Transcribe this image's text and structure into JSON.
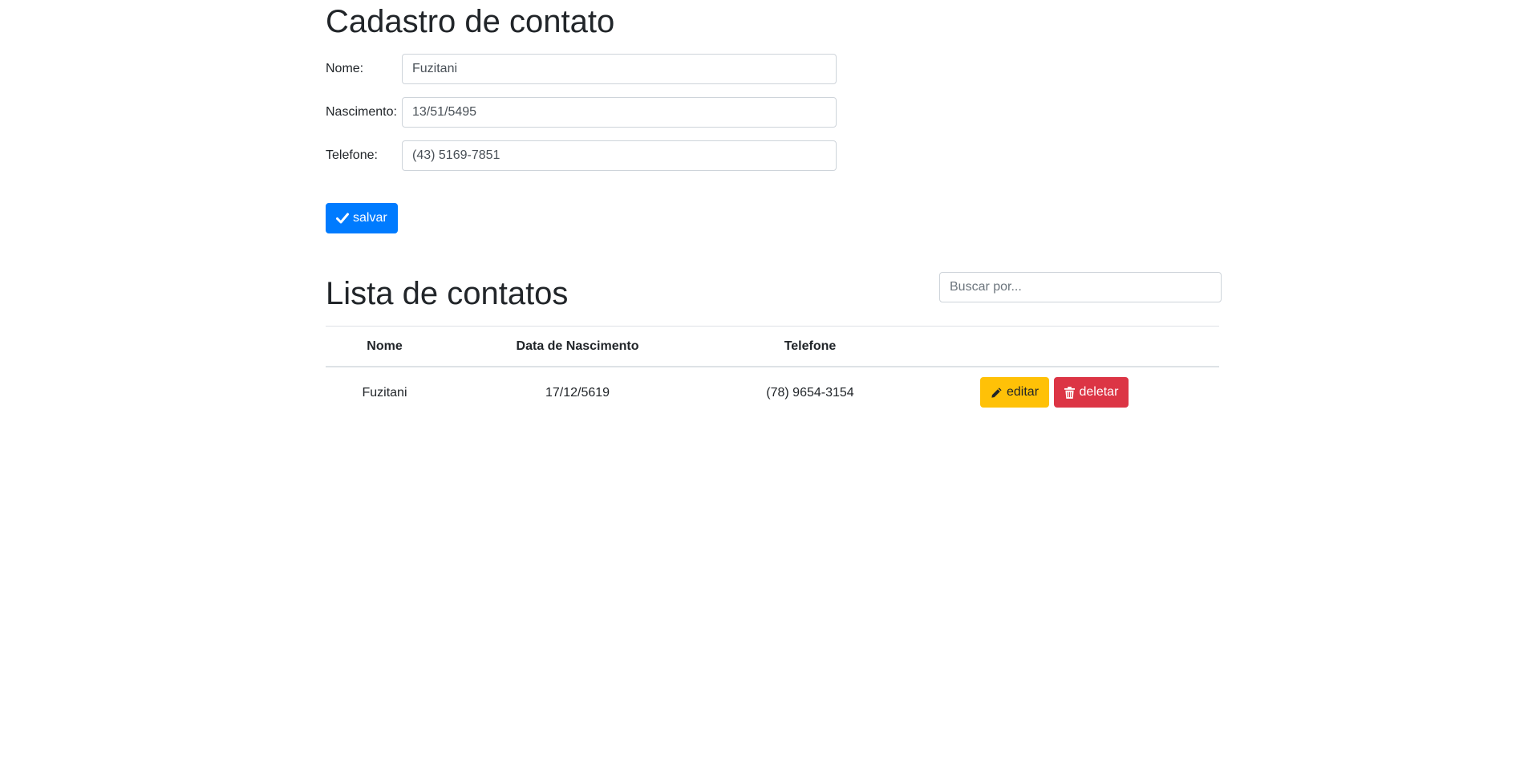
{
  "form": {
    "title": "Cadastro de contato",
    "fields": [
      {
        "label": "Nome:",
        "value": "Fuzitani"
      },
      {
        "label": "Nascimento:",
        "value": "13/51/5495"
      },
      {
        "label": "Telefone:",
        "value": "(43) 5169-7851"
      }
    ],
    "save_label": "salvar"
  },
  "list": {
    "title": "Lista de contatos",
    "search_placeholder": "Buscar por...",
    "columns": [
      "Nome",
      "Data de Nascimento",
      "Telefone",
      ""
    ],
    "rows": [
      {
        "nome": "Fuzitani",
        "nascimento": "17/12/5619",
        "telefone": "(78) 9654-3154"
      }
    ],
    "edit_label": "editar",
    "delete_label": "deletar"
  },
  "colors": {
    "primary": "#007bff",
    "warning": "#ffc107",
    "danger": "#dc3545"
  },
  "icons": {
    "save": "check-icon",
    "edit": "pencil-icon",
    "delete": "trash-icon"
  }
}
